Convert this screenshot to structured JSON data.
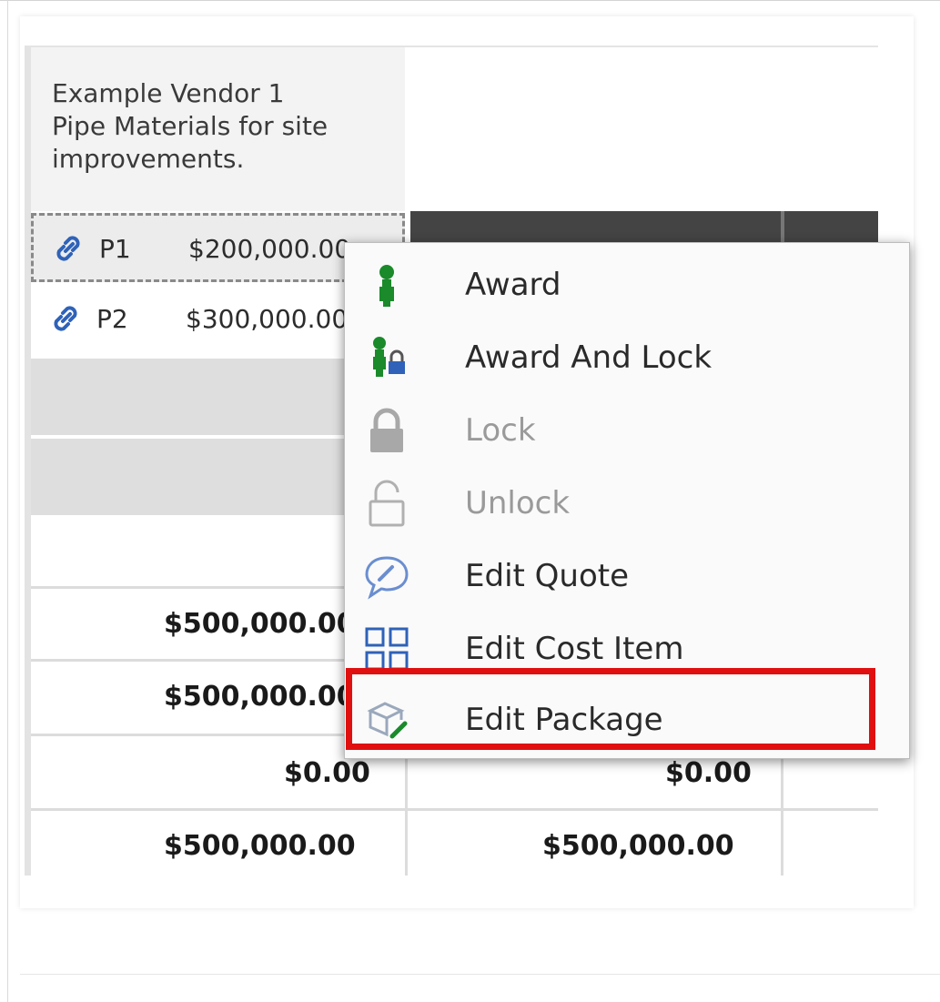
{
  "vendor": {
    "name_line": "Example Vendor 1",
    "desc_line1": "Pipe Materials for site",
    "desc_line2": "improvements."
  },
  "packages": [
    {
      "label": "P1",
      "amount": "$200,000.00"
    },
    {
      "label": "P2",
      "amount": "$300,000.00"
    }
  ],
  "totals": {
    "row1_col1": "$500,000.00",
    "row2_col1": "$500,000.00",
    "row3_col1": "$0.00",
    "row3_col2": "$0.00",
    "row4_col1": "$500,000.00",
    "row4_col2": "$500,000.00"
  },
  "context_menu": {
    "items": [
      {
        "label": "Award",
        "enabled": true,
        "icon": "award-icon"
      },
      {
        "label": "Award And Lock",
        "enabled": true,
        "icon": "award-lock-icon"
      },
      {
        "label": "Lock",
        "enabled": false,
        "icon": "lock-icon"
      },
      {
        "label": "Unlock",
        "enabled": false,
        "icon": "unlock-icon"
      },
      {
        "label": "Edit Quote",
        "enabled": true,
        "icon": "edit-quote-icon"
      },
      {
        "label": "Edit Cost Item",
        "enabled": true,
        "icon": "edit-cost-item-icon"
      },
      {
        "label": "Edit Package",
        "enabled": true,
        "icon": "edit-package-icon",
        "highlighted": true
      }
    ]
  },
  "colors": {
    "highlight": "#e01010",
    "award_green": "#1a8a2a",
    "link_blue": "#2f62b8"
  }
}
